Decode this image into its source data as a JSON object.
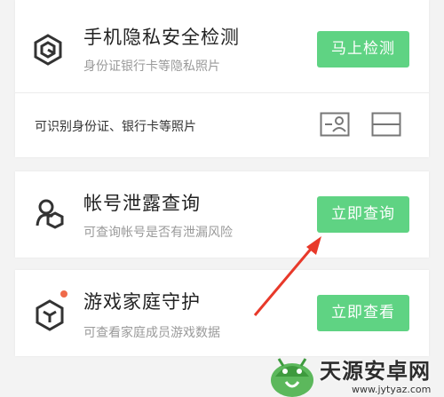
{
  "colors": {
    "accent": "#5fd383",
    "background": "#f3f3f3",
    "card": "#ffffff",
    "notification_dot": "#ef6a4a",
    "annotation_arrow": "#e8392a"
  },
  "privacy_check": {
    "icon": "shield-hexagon-icon",
    "title": "手机隐私安全检测",
    "subtitle": "身份证银行卡等隐私照片",
    "button_label": "马上检测",
    "info_text": "可识别身份证、银行卡等照片",
    "info_icons": [
      "id-card-icon",
      "bank-card-icon"
    ]
  },
  "account_leak": {
    "icon": "account-shield-icon",
    "title": "帐号泄露查询",
    "subtitle": "可查询帐号是否有泄漏风险",
    "button_label": "立即查询"
  },
  "family_game": {
    "icon": "game-cube-icon",
    "title": "游戏家庭守护",
    "subtitle": "可查看家庭成员游戏数据",
    "button_label": "立即查看",
    "has_notification_dot": true
  },
  "watermark": {
    "title": "天源安卓网",
    "url": "www.jytyaz.com"
  }
}
